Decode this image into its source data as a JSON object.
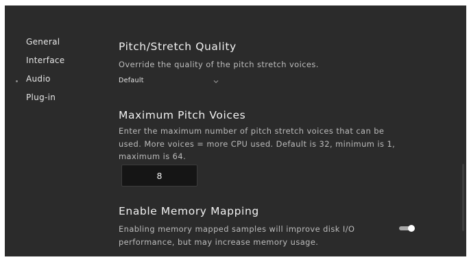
{
  "sidebar": {
    "items": [
      {
        "label": "General"
      },
      {
        "label": "Interface"
      },
      {
        "label": "Audio",
        "selected": true
      },
      {
        "label": "Plug-in"
      }
    ]
  },
  "pitch_quality": {
    "title": "Pitch/Stretch Quality",
    "description": "Override the quality of the pitch stretch voices.",
    "selected": "Default"
  },
  "max_voices": {
    "title": "Maximum Pitch Voices",
    "description_lines": [
      "Enter the maximum number of pitch stretch voices that can be",
      "used. More voices = more CPU used. Default is 32, minimum is 1,",
      "maximum is 64."
    ],
    "value": "8"
  },
  "memory_mapping": {
    "title": "Enable Memory Mapping",
    "description_lines": [
      "Enabling memory mapped samples will improve disk I/O",
      "performance, but may increase memory usage."
    ],
    "enabled": true
  },
  "icons": {
    "select_chevron": "chevron-down-icon",
    "nav_indicator": "dot-icon"
  },
  "colors": {
    "background": "#2b2b2b",
    "text": "#f2f2f2",
    "muted": "#bdbdbd",
    "input_bg": "#151515"
  }
}
